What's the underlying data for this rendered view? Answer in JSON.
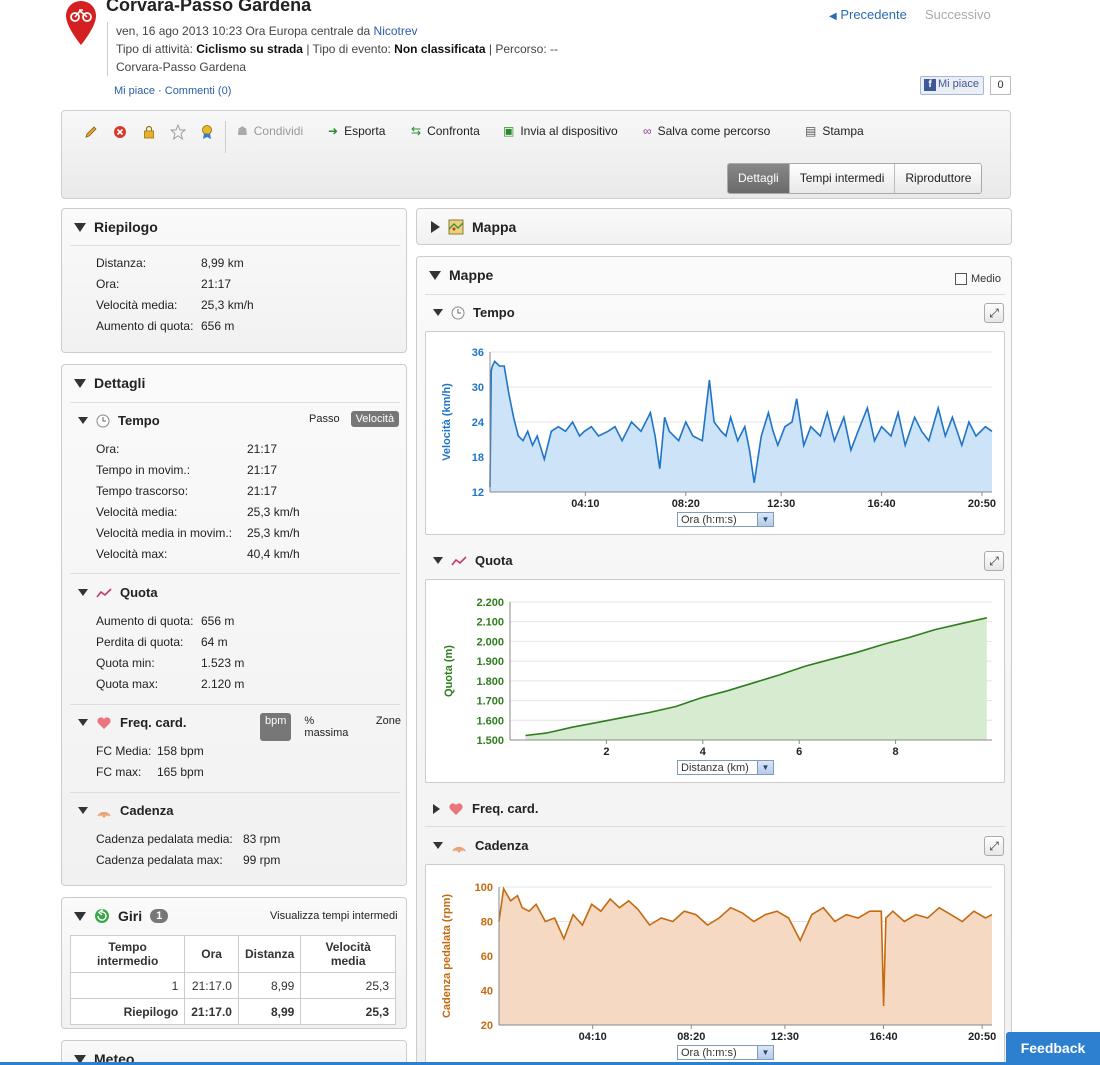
{
  "header": {
    "title": "Corvara-Passo Gardena",
    "date_line": "ven, 16 ago 2013 10:23 Ora Europa centrale da ",
    "author": "Nicotrev",
    "activity_label": "Tipo di attività: ",
    "activity": "Ciclismo su strada",
    "event_label": " | Tipo di evento: ",
    "event": "Non classificata",
    "route_label": " | Percorso: --",
    "location": "Corvara-Passo Gardena",
    "like": "Mi piace",
    "sep": " · ",
    "comments": "Commenti (0)",
    "prev": "Precedente",
    "next": "Successivo",
    "fb_like": "Mi piace",
    "fb_count": "0"
  },
  "toolbar": {
    "share": "Condividi",
    "export": "Esporta",
    "compare": "Confronta",
    "send": "Invia al dispositivo",
    "save_route": "Salva come percorso",
    "print": "Stampa",
    "tabs": [
      "Dettagli",
      "Tempi intermedi",
      "Riproduttore"
    ]
  },
  "summary": {
    "title": "Riepilogo",
    "rows": [
      [
        "Distanza:",
        "8,99 km"
      ],
      [
        "Ora:",
        "21:17"
      ],
      [
        "Velocità media:",
        "25,3 km/h"
      ],
      [
        "Aumento di quota:",
        "656 m"
      ]
    ]
  },
  "details": {
    "title": "Dettagli",
    "time": {
      "title": "Tempo",
      "pace": "Passo",
      "speed": "Velocità",
      "rows": [
        [
          "Ora:",
          "21:17"
        ],
        [
          "Tempo in movim.:",
          "21:17"
        ],
        [
          "Tempo trascorso:",
          "21:17"
        ],
        [
          "Velocità media:",
          "25,3 km/h"
        ],
        [
          "Velocità media in movim.:",
          "25,3 km/h"
        ],
        [
          "Velocità max:",
          "40,4 km/h"
        ]
      ]
    },
    "elev": {
      "title": "Quota",
      "rows": [
        [
          "Aumento di quota:",
          "656 m"
        ],
        [
          "Perdita di quota:",
          "64 m"
        ],
        [
          "Quota min:",
          "1.523 m"
        ],
        [
          "Quota max:",
          "2.120 m"
        ]
      ]
    },
    "hr": {
      "title": "Freq. card.",
      "bpm": "bpm",
      "max": "% massima",
      "zones": "Zone",
      "rows": [
        [
          "FC Media:",
          "158 bpm"
        ],
        [
          "FC max:",
          "165 bpm"
        ]
      ]
    },
    "cad": {
      "title": "Cadenza",
      "rows": [
        [
          "Cadenza pedalata media:",
          "83 rpm"
        ],
        [
          "Cadenza pedalata max:",
          "99 rpm"
        ]
      ]
    }
  },
  "laps": {
    "title": "Giri",
    "count": "1",
    "link": "Visualizza tempi intermedi",
    "headers": [
      "Tempo intermedio",
      "Ora",
      "Distanza",
      "Velocità media"
    ],
    "rows": [
      [
        "1",
        "21:17.0",
        "8,99",
        "25,3"
      ],
      [
        "Riepilogo",
        "21:17.0",
        "8,99",
        "25,3"
      ]
    ]
  },
  "meteo": {
    "title": "Meteo"
  },
  "map": {
    "title": "Mappa"
  },
  "charts_panel": {
    "title": "Mappe",
    "avg": "Medio",
    "time": "Tempo",
    "elev": "Quota",
    "hr": "Freq. card.",
    "cad": "Cadenza",
    "sel_time": "Ora (h:m:s)",
    "sel_dist": "Distanza (km)"
  },
  "feedback": "Feedback",
  "chart_data": [
    {
      "type": "area",
      "ylabel": "Velocità (km/h)",
      "ylim": [
        12,
        42
      ],
      "yticks": [
        "12",
        "18",
        "24",
        "30",
        "36"
      ],
      "xticks": [
        "04:10",
        "08:20",
        "12:30",
        "16:40",
        "20:50"
      ],
      "xlim": [
        0,
        21.28
      ],
      "color": "#1f74c8",
      "fill": "#cde3f7",
      "x": [
        0,
        0.05,
        0.1,
        0.2,
        0.4,
        0.6,
        0.8,
        1.0,
        1.2,
        1.4,
        1.6,
        1.8,
        2.0,
        2.3,
        2.6,
        2.9,
        3.2,
        3.5,
        3.8,
        4.0,
        4.3,
        4.6,
        5.0,
        5.3,
        5.6,
        6.0,
        6.4,
        6.8,
        7.0,
        7.2,
        7.4,
        7.6,
        8.0,
        8.3,
        8.6,
        9.0,
        9.3,
        9.5,
        9.8,
        10.0,
        10.2,
        10.5,
        10.8,
        11.0,
        11.2,
        11.5,
        11.8,
        12.0,
        12.2,
        12.5,
        12.8,
        13.0,
        13.3,
        13.6,
        14.0,
        14.3,
        14.6,
        15.0,
        15.3,
        15.6,
        16.0,
        16.3,
        16.6,
        17.0,
        17.3,
        17.6,
        18.0,
        18.3,
        18.6,
        19.0,
        19.3,
        19.6,
        20.0,
        20.3,
        20.6,
        21.0,
        21.28
      ],
      "y": [
        13,
        38,
        39,
        40,
        39,
        39,
        33,
        28,
        24,
        23,
        25,
        22,
        24,
        19,
        25,
        26,
        25,
        27,
        24,
        25,
        26,
        24,
        25,
        26,
        23,
        27,
        25,
        29,
        24,
        17,
        28,
        25,
        23,
        27,
        24,
        23,
        36,
        27,
        25,
        24,
        28,
        23,
        26,
        21,
        14,
        24,
        29,
        25,
        22,
        26,
        27,
        32,
        22,
        26,
        24,
        29,
        23,
        28,
        21,
        25,
        30,
        23,
        26,
        24,
        29,
        22,
        28,
        25,
        23,
        30,
        24,
        28,
        22,
        27,
        24,
        26,
        25
      ]
    },
    {
      "type": "area",
      "ylabel": "Quota (m)",
      "ylim": [
        1500,
        2200
      ],
      "yticks": [
        "1.500",
        "1.600",
        "1.700",
        "1.800",
        "1.900",
        "2.000",
        "2.100",
        "2.200"
      ],
      "xticks": [
        "2",
        "4",
        "6",
        "8"
      ],
      "xlim": [
        -0.2,
        9.1
      ],
      "color": "#2e7d1e",
      "fill": "#d6ebd0",
      "x": [
        0.1,
        0.5,
        1,
        1.5,
        2,
        2.5,
        3,
        3.5,
        4,
        4.5,
        5,
        5.5,
        6,
        6.5,
        7,
        7.5,
        8,
        8.5,
        9
      ],
      "y": [
        1523,
        1535,
        1565,
        1590,
        1615,
        1640,
        1670,
        1715,
        1750,
        1790,
        1830,
        1875,
        1910,
        1945,
        1985,
        2020,
        2060,
        2090,
        2120
      ]
    },
    {
      "type": "area",
      "ylabel": "Cadenza pedalata (rpm)",
      "ylim": [
        20,
        100
      ],
      "yticks": [
        "20",
        "40",
        "60",
        "80",
        "100"
      ],
      "xticks": [
        "04:10",
        "08:20",
        "12:30",
        "16:40",
        "20:50"
      ],
      "xlim": [
        0,
        21.28
      ],
      "color": "#c46a10",
      "fill": "#f6d9c2",
      "x": [
        0,
        0.2,
        0.5,
        0.8,
        1.0,
        1.3,
        1.6,
        2.0,
        2.4,
        2.8,
        3.2,
        3.6,
        4.0,
        4.4,
        4.8,
        5.2,
        5.6,
        6.0,
        6.5,
        7.0,
        7.5,
        8.0,
        8.5,
        9.0,
        9.5,
        10.0,
        10.5,
        11.0,
        11.5,
        12.0,
        12.5,
        13.0,
        13.5,
        14.0,
        14.5,
        15.0,
        15.5,
        16.0,
        16.5,
        16.6,
        16.7,
        17.0,
        17.5,
        18.0,
        18.5,
        19.0,
        19.5,
        20.0,
        20.5,
        21.0,
        21.28
      ],
      "y": [
        80,
        99,
        92,
        95,
        88,
        86,
        90,
        80,
        82,
        70,
        84,
        78,
        90,
        86,
        93,
        88,
        92,
        87,
        78,
        82,
        80,
        86,
        84,
        78,
        82,
        88,
        85,
        80,
        84,
        86,
        82,
        69,
        84,
        88,
        80,
        84,
        82,
        86,
        86,
        31,
        82,
        86,
        80,
        84,
        82,
        88,
        84,
        80,
        86,
        82,
        84
      ]
    }
  ]
}
